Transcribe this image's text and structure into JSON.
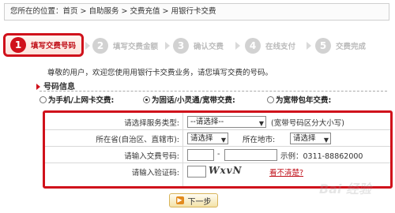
{
  "breadcrumb": "您所在的位置：首页 > 自助服务 > 交费充值 > 用银行卡交费",
  "steps": [
    {
      "num": "1",
      "label": "填写交费号码"
    },
    {
      "num": "2",
      "label": "填写交费金额"
    },
    {
      "num": "3",
      "label": "确认交费"
    },
    {
      "num": "4",
      "label": "在线支付"
    },
    {
      "num": "5",
      "label": "交费完成"
    }
  ],
  "intro": "尊敬的用户，欢迎您使用用银行卡交费业务，请您填写交费的号码。",
  "section_title": "号码信息",
  "radios": [
    {
      "label": "为手机/上网卡交费:",
      "selected": false
    },
    {
      "label": "为固话/小灵通/宽带交费:",
      "selected": true
    },
    {
      "label": "为宽带包年交费:",
      "selected": false
    }
  ],
  "form": {
    "service_type": {
      "label": "请选择服务类型:",
      "value": "--请选择--",
      "hint": "(宽带号码区分大小写)"
    },
    "province": {
      "label": "所在省(自治区、直辖市):",
      "value": "请选择"
    },
    "city": {
      "label": "所在地市:",
      "value": "请选择"
    },
    "number": {
      "label": "请输入交费号码:",
      "separator": "-",
      "example": "示例：0311-88862000"
    },
    "captcha": {
      "label": "请输入验证码:",
      "image_text": "WxvN",
      "refresh_link": "看不清楚?"
    }
  },
  "next_button": "下一步",
  "watermark": "Bai 经验",
  "colors": {
    "accent": "#d0111b",
    "inactive_step": "#d2d2d2"
  }
}
